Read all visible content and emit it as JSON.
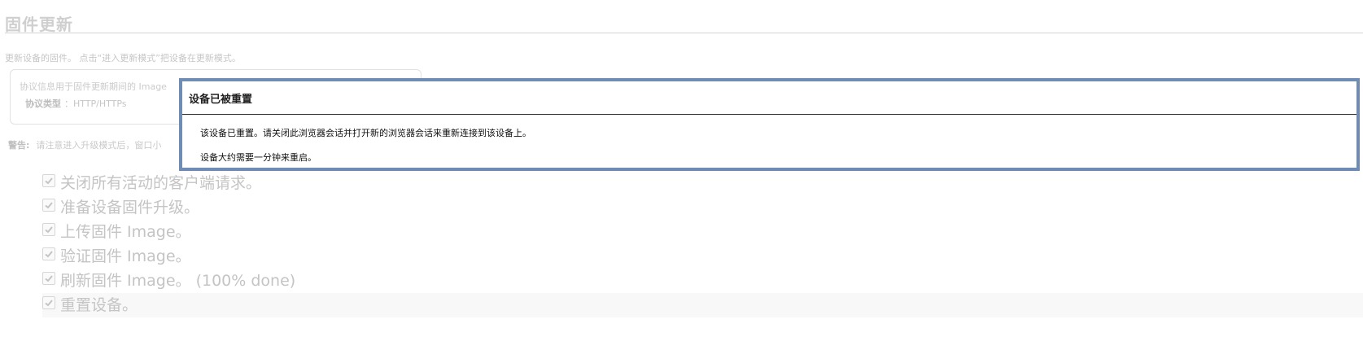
{
  "page": {
    "title": "固件更新",
    "description": "更新设备的固件。 点击“进入更新模式”把设备在更新模式。",
    "info": {
      "line1": "协议信息用于固件更新期间的 Image",
      "protocol_label": "协议类型",
      "protocol_value": "：HTTP/HTTPs"
    },
    "warning": {
      "label": "警告:",
      "text": "请注意进入升级模式后，窗口小"
    }
  },
  "steps": [
    {
      "label": "关闭所有活动的客户端请求。",
      "checked": true
    },
    {
      "label": "准备设备固件升级。",
      "checked": true
    },
    {
      "label": "上传固件 Image。",
      "checked": true
    },
    {
      "label": "验证固件 Image。",
      "checked": true
    },
    {
      "label": "刷新固件 Image。 (100% done)",
      "checked": true
    },
    {
      "label": "重置设备。",
      "checked": true
    }
  ],
  "modal": {
    "title": "设备已被重置",
    "message1": "该设备已重置。请关闭此浏览器会话并打开新的浏览器会话来重新连接到该设备上。",
    "message2": "设备大约需要一分钟来重启。",
    "border_color": "#6f8cb5"
  }
}
